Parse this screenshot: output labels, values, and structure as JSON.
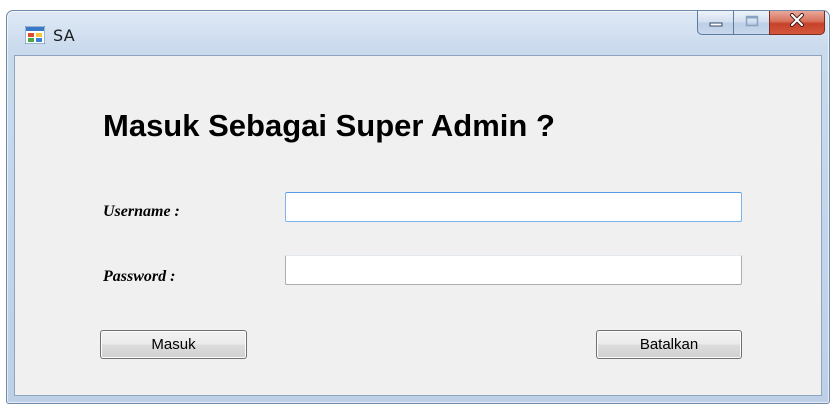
{
  "window": {
    "title": "SA",
    "app_icon": "windows-form-icon",
    "caption_buttons": {
      "minimize_icon": "minimize-icon",
      "maximize_icon": "maximize-icon",
      "close_icon": "close-icon"
    }
  },
  "form": {
    "heading": "Masuk Sebagai Super Admin ?",
    "username_label": "Username :",
    "username_value": "",
    "password_label": "Password  :",
    "password_value": "",
    "login_button": "Masuk",
    "cancel_button": "Batalkan"
  },
  "colors": {
    "window_frame": "#bdd0e6",
    "client_area": "#f0f0f0",
    "close_button": "#c7412a",
    "focused_input_border": "#569de5"
  }
}
